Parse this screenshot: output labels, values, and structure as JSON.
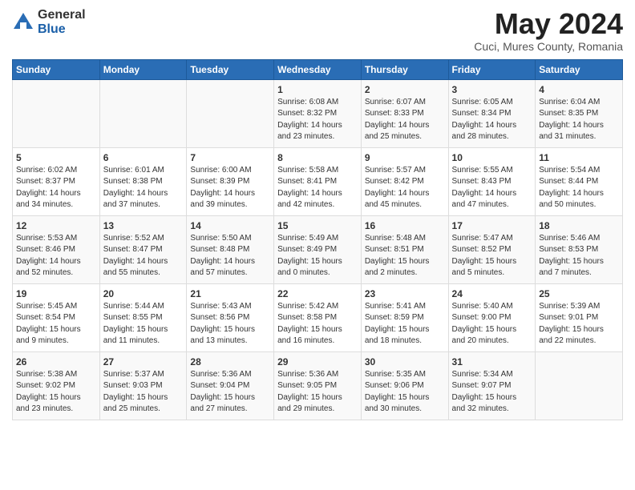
{
  "logo": {
    "general": "General",
    "blue": "Blue"
  },
  "header": {
    "month_year": "May 2024",
    "location": "Cuci, Mures County, Romania"
  },
  "days_of_week": [
    "Sunday",
    "Monday",
    "Tuesday",
    "Wednesday",
    "Thursday",
    "Friday",
    "Saturday"
  ],
  "weeks": [
    [
      {
        "day": "",
        "info": ""
      },
      {
        "day": "",
        "info": ""
      },
      {
        "day": "",
        "info": ""
      },
      {
        "day": "1",
        "info": "Sunrise: 6:08 AM\nSunset: 8:32 PM\nDaylight: 14 hours\nand 23 minutes."
      },
      {
        "day": "2",
        "info": "Sunrise: 6:07 AM\nSunset: 8:33 PM\nDaylight: 14 hours\nand 25 minutes."
      },
      {
        "day": "3",
        "info": "Sunrise: 6:05 AM\nSunset: 8:34 PM\nDaylight: 14 hours\nand 28 minutes."
      },
      {
        "day": "4",
        "info": "Sunrise: 6:04 AM\nSunset: 8:35 PM\nDaylight: 14 hours\nand 31 minutes."
      }
    ],
    [
      {
        "day": "5",
        "info": "Sunrise: 6:02 AM\nSunset: 8:37 PM\nDaylight: 14 hours\nand 34 minutes."
      },
      {
        "day": "6",
        "info": "Sunrise: 6:01 AM\nSunset: 8:38 PM\nDaylight: 14 hours\nand 37 minutes."
      },
      {
        "day": "7",
        "info": "Sunrise: 6:00 AM\nSunset: 8:39 PM\nDaylight: 14 hours\nand 39 minutes."
      },
      {
        "day": "8",
        "info": "Sunrise: 5:58 AM\nSunset: 8:41 PM\nDaylight: 14 hours\nand 42 minutes."
      },
      {
        "day": "9",
        "info": "Sunrise: 5:57 AM\nSunset: 8:42 PM\nDaylight: 14 hours\nand 45 minutes."
      },
      {
        "day": "10",
        "info": "Sunrise: 5:55 AM\nSunset: 8:43 PM\nDaylight: 14 hours\nand 47 minutes."
      },
      {
        "day": "11",
        "info": "Sunrise: 5:54 AM\nSunset: 8:44 PM\nDaylight: 14 hours\nand 50 minutes."
      }
    ],
    [
      {
        "day": "12",
        "info": "Sunrise: 5:53 AM\nSunset: 8:46 PM\nDaylight: 14 hours\nand 52 minutes."
      },
      {
        "day": "13",
        "info": "Sunrise: 5:52 AM\nSunset: 8:47 PM\nDaylight: 14 hours\nand 55 minutes."
      },
      {
        "day": "14",
        "info": "Sunrise: 5:50 AM\nSunset: 8:48 PM\nDaylight: 14 hours\nand 57 minutes."
      },
      {
        "day": "15",
        "info": "Sunrise: 5:49 AM\nSunset: 8:49 PM\nDaylight: 15 hours\nand 0 minutes."
      },
      {
        "day": "16",
        "info": "Sunrise: 5:48 AM\nSunset: 8:51 PM\nDaylight: 15 hours\nand 2 minutes."
      },
      {
        "day": "17",
        "info": "Sunrise: 5:47 AM\nSunset: 8:52 PM\nDaylight: 15 hours\nand 5 minutes."
      },
      {
        "day": "18",
        "info": "Sunrise: 5:46 AM\nSunset: 8:53 PM\nDaylight: 15 hours\nand 7 minutes."
      }
    ],
    [
      {
        "day": "19",
        "info": "Sunrise: 5:45 AM\nSunset: 8:54 PM\nDaylight: 15 hours\nand 9 minutes."
      },
      {
        "day": "20",
        "info": "Sunrise: 5:44 AM\nSunset: 8:55 PM\nDaylight: 15 hours\nand 11 minutes."
      },
      {
        "day": "21",
        "info": "Sunrise: 5:43 AM\nSunset: 8:56 PM\nDaylight: 15 hours\nand 13 minutes."
      },
      {
        "day": "22",
        "info": "Sunrise: 5:42 AM\nSunset: 8:58 PM\nDaylight: 15 hours\nand 16 minutes."
      },
      {
        "day": "23",
        "info": "Sunrise: 5:41 AM\nSunset: 8:59 PM\nDaylight: 15 hours\nand 18 minutes."
      },
      {
        "day": "24",
        "info": "Sunrise: 5:40 AM\nSunset: 9:00 PM\nDaylight: 15 hours\nand 20 minutes."
      },
      {
        "day": "25",
        "info": "Sunrise: 5:39 AM\nSunset: 9:01 PM\nDaylight: 15 hours\nand 22 minutes."
      }
    ],
    [
      {
        "day": "26",
        "info": "Sunrise: 5:38 AM\nSunset: 9:02 PM\nDaylight: 15 hours\nand 23 minutes."
      },
      {
        "day": "27",
        "info": "Sunrise: 5:37 AM\nSunset: 9:03 PM\nDaylight: 15 hours\nand 25 minutes."
      },
      {
        "day": "28",
        "info": "Sunrise: 5:36 AM\nSunset: 9:04 PM\nDaylight: 15 hours\nand 27 minutes."
      },
      {
        "day": "29",
        "info": "Sunrise: 5:36 AM\nSunset: 9:05 PM\nDaylight: 15 hours\nand 29 minutes."
      },
      {
        "day": "30",
        "info": "Sunrise: 5:35 AM\nSunset: 9:06 PM\nDaylight: 15 hours\nand 30 minutes."
      },
      {
        "day": "31",
        "info": "Sunrise: 5:34 AM\nSunset: 9:07 PM\nDaylight: 15 hours\nand 32 minutes."
      },
      {
        "day": "",
        "info": ""
      }
    ]
  ]
}
